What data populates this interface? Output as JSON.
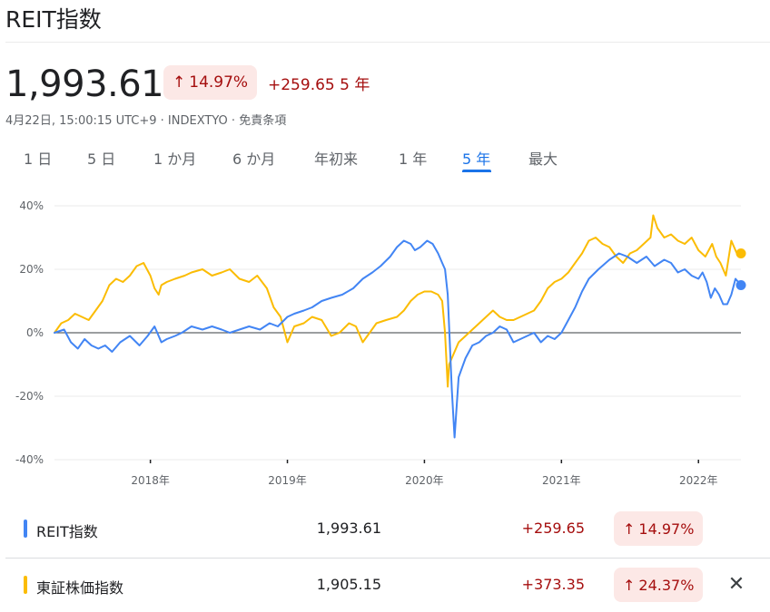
{
  "header": {
    "title": "REIT指数"
  },
  "quote": {
    "price": "1,993.61",
    "pct_change": "14.97%",
    "abs_change": "+259.65",
    "period_label": "5 年",
    "meta": "4月22日, 15:00:15 UTC+9 · INDEXTYO · 免責条項",
    "arrow": "↑"
  },
  "tabs": [
    {
      "label": "1 日",
      "active": false
    },
    {
      "label": "5 日",
      "active": false
    },
    {
      "label": "1 か月",
      "active": false
    },
    {
      "label": "6 か月",
      "active": false
    },
    {
      "label": "年初来",
      "active": false
    },
    {
      "label": "1 年",
      "active": false
    },
    {
      "label": "5 年",
      "active": true
    },
    {
      "label": "最大",
      "active": false
    }
  ],
  "chart_data": {
    "type": "line",
    "title": "",
    "xlabel": "",
    "ylabel": "",
    "y_ticks": [
      "40%",
      "20%",
      "0%",
      "-20%",
      "-40%"
    ],
    "ylim": [
      -40,
      40
    ],
    "x_ticks": [
      {
        "label": "2018年",
        "x": 2018.0
      },
      {
        "label": "2019年",
        "x": 2019.0
      },
      {
        "label": "2020年",
        "x": 2020.0
      },
      {
        "label": "2021年",
        "x": 2021.0
      },
      {
        "label": "2022年",
        "x": 2022.0
      }
    ],
    "xlim": [
      2017.3,
      2022.31
    ],
    "grid": "horizontal",
    "colors": {
      "reit": "#4285f4",
      "topix": "#fbbc04"
    },
    "series": [
      {
        "name": "REIT指数",
        "color": "#4285f4",
        "x": [
          2017.3,
          2017.37,
          2017.42,
          2017.47,
          2017.52,
          2017.57,
          2017.62,
          2017.67,
          2017.72,
          2017.78,
          2017.85,
          2017.92,
          2017.98,
          2018.03,
          2018.08,
          2018.12,
          2018.18,
          2018.23,
          2018.3,
          2018.38,
          2018.45,
          2018.52,
          2018.58,
          2018.65,
          2018.72,
          2018.8,
          2018.87,
          2018.93,
          2019.0,
          2019.05,
          2019.12,
          2019.18,
          2019.25,
          2019.32,
          2019.4,
          2019.48,
          2019.55,
          2019.62,
          2019.68,
          2019.75,
          2019.8,
          2019.85,
          2019.9,
          2019.93,
          2019.97,
          2020.02,
          2020.06,
          2020.1,
          2020.13,
          2020.15,
          2020.17,
          2020.18,
          2020.2,
          2020.22,
          2020.25,
          2020.3,
          2020.35,
          2020.4,
          2020.45,
          2020.5,
          2020.55,
          2020.6,
          2020.65,
          2020.7,
          2020.75,
          2020.8,
          2020.85,
          2020.9,
          2020.95,
          2021.0,
          2021.05,
          2021.1,
          2021.15,
          2021.2,
          2021.27,
          2021.35,
          2021.42,
          2021.48,
          2021.55,
          2021.62,
          2021.68,
          2021.75,
          2021.8,
          2021.85,
          2021.9,
          2021.95,
          2022.0,
          2022.03,
          2022.06,
          2022.09,
          2022.12,
          2022.15,
          2022.18,
          2022.21,
          2022.24,
          2022.27,
          2022.31
        ],
        "y": [
          0,
          1,
          -3,
          -5,
          -2,
          -4,
          -5,
          -4,
          -6,
          -3,
          -1,
          -4,
          -1,
          2,
          -3,
          -2,
          -1,
          0,
          2,
          1,
          2,
          1,
          0,
          1,
          2,
          1,
          3,
          2,
          5,
          6,
          7,
          8,
          10,
          11,
          12,
          14,
          17,
          19,
          21,
          24,
          27,
          29,
          28,
          26,
          27,
          29,
          28,
          25,
          22,
          20,
          12,
          2,
          -18,
          -33,
          -14,
          -8,
          -4,
          -3,
          -1,
          0,
          2,
          1,
          -3,
          -2,
          -1,
          0,
          -3,
          -1,
          -2,
          0,
          4,
          8,
          13,
          17,
          20,
          23,
          25,
          24,
          22,
          24,
          21,
          23,
          22,
          19,
          20,
          18,
          17,
          19,
          16,
          11,
          14,
          12,
          9,
          9,
          12,
          17,
          15
        ]
      },
      {
        "name": "東証株価指数",
        "color": "#fbbc04",
        "x": [
          2017.3,
          2017.35,
          2017.4,
          2017.45,
          2017.5,
          2017.55,
          2017.6,
          2017.65,
          2017.7,
          2017.75,
          2017.8,
          2017.85,
          2017.9,
          2017.95,
          2018.0,
          2018.03,
          2018.06,
          2018.08,
          2018.12,
          2018.18,
          2018.25,
          2018.3,
          2018.38,
          2018.45,
          2018.52,
          2018.58,
          2018.65,
          2018.72,
          2018.78,
          2018.85,
          2018.9,
          2018.95,
          2019.0,
          2019.05,
          2019.12,
          2019.18,
          2019.25,
          2019.32,
          2019.38,
          2019.45,
          2019.5,
          2019.55,
          2019.6,
          2019.65,
          2019.72,
          2019.8,
          2019.85,
          2019.9,
          2019.95,
          2020.0,
          2020.05,
          2020.1,
          2020.13,
          2020.15,
          2020.17,
          2020.18,
          2020.2,
          2020.22,
          2020.25,
          2020.3,
          2020.35,
          2020.4,
          2020.45,
          2020.5,
          2020.55,
          2020.6,
          2020.65,
          2020.7,
          2020.75,
          2020.8,
          2020.85,
          2020.9,
          2020.95,
          2021.0,
          2021.05,
          2021.1,
          2021.15,
          2021.2,
          2021.25,
          2021.3,
          2021.35,
          2021.4,
          2021.45,
          2021.5,
          2021.55,
          2021.6,
          2021.65,
          2021.67,
          2021.7,
          2021.75,
          2021.8,
          2021.85,
          2021.9,
          2021.95,
          2022.0,
          2022.05,
          2022.1,
          2022.13,
          2022.16,
          2022.2,
          2022.24,
          2022.28,
          2022.31
        ],
        "y": [
          0,
          3,
          4,
          6,
          5,
          4,
          7,
          10,
          15,
          17,
          16,
          18,
          21,
          22,
          18,
          14,
          12,
          15,
          16,
          17,
          18,
          19,
          20,
          18,
          19,
          20,
          17,
          16,
          18,
          14,
          8,
          5,
          -3,
          2,
          3,
          5,
          4,
          -1,
          0,
          3,
          2,
          -3,
          0,
          3,
          4,
          5,
          7,
          10,
          12,
          13,
          13,
          12,
          10,
          0,
          -17,
          -10,
          -8,
          -6,
          -3,
          -1,
          1,
          3,
          5,
          7,
          5,
          4,
          4,
          5,
          6,
          7,
          10,
          14,
          16,
          17,
          19,
          22,
          25,
          29,
          30,
          28,
          27,
          24,
          22,
          25,
          26,
          28,
          30,
          37,
          33,
          30,
          31,
          29,
          28,
          30,
          26,
          24,
          28,
          24,
          22,
          18,
          29,
          25,
          25
        ]
      }
    ]
  },
  "legend": [
    {
      "name": "REIT指数",
      "value": "1,993.61",
      "change": "+259.65",
      "pct": "14.97%",
      "color": "#4285f4"
    },
    {
      "name": "東証株価指数",
      "value": "1,905.15",
      "change": "+373.35",
      "pct": "24.37%",
      "color": "#fbbc04"
    }
  ],
  "close_glyph": "✕"
}
